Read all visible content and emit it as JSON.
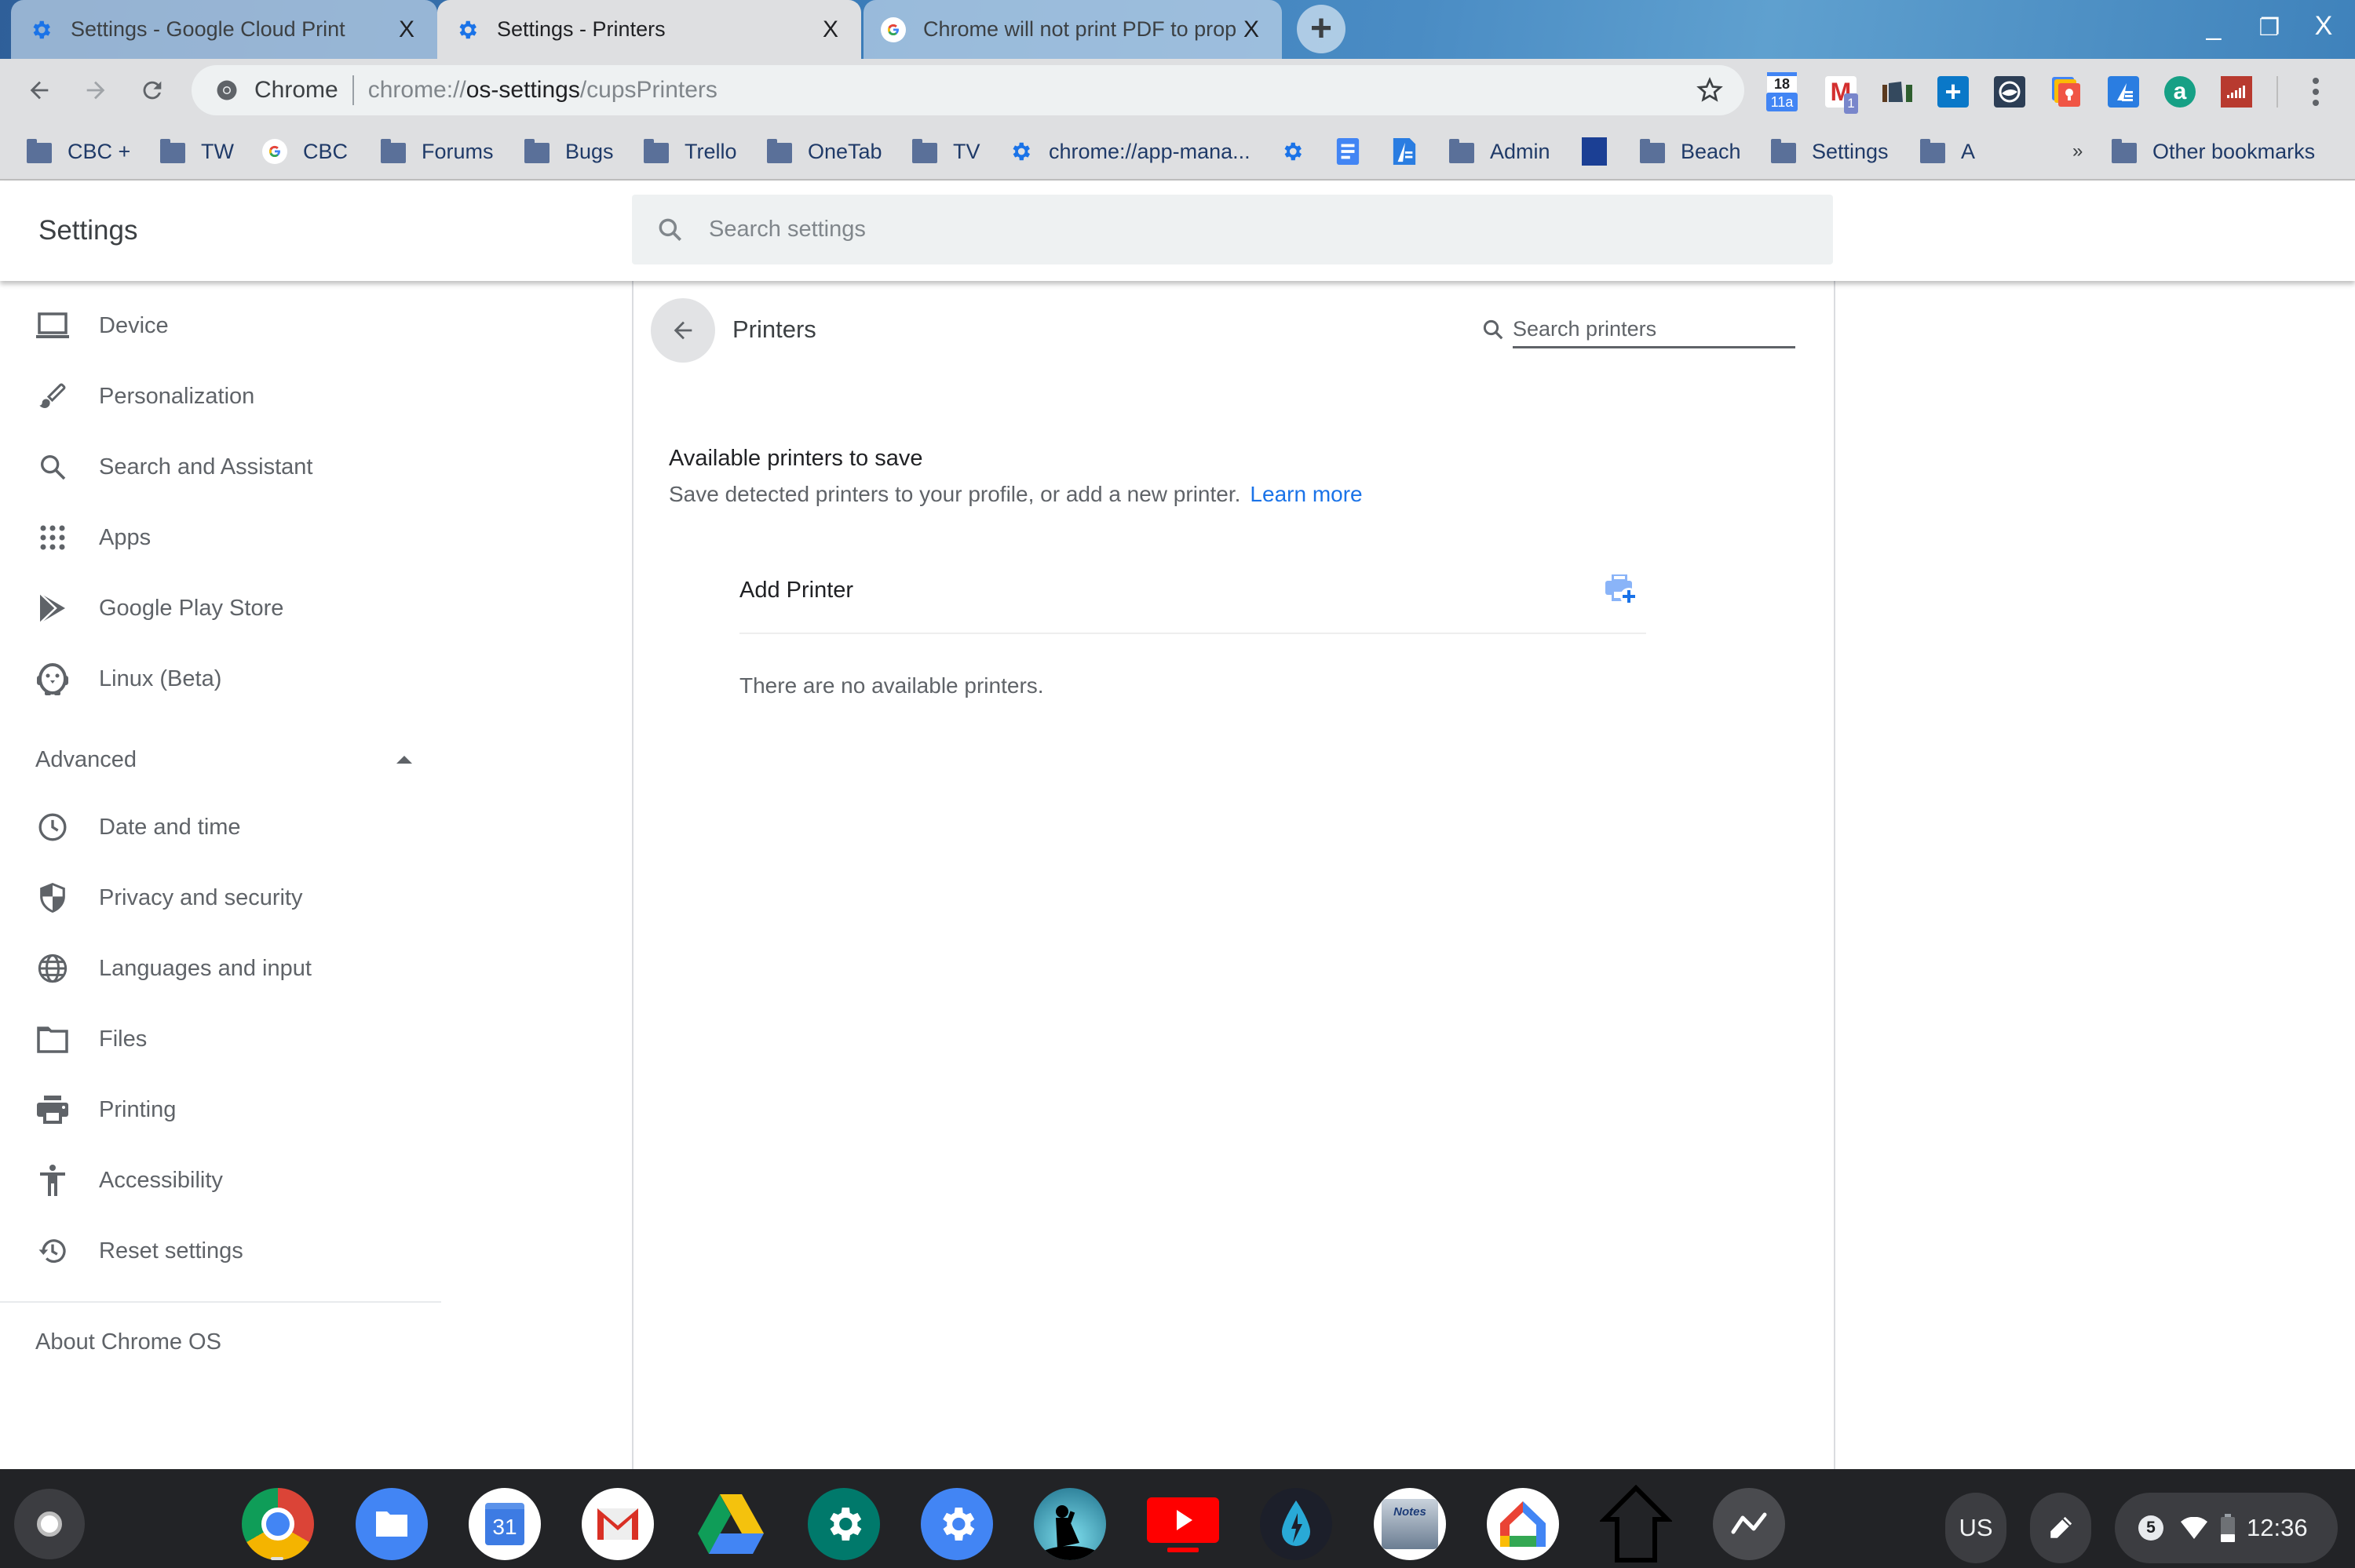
{
  "browser": {
    "tabs": [
      {
        "title": "Settings - Google Cloud Print",
        "favicon": "gear-icon",
        "active": false
      },
      {
        "title": "Settings - Printers",
        "favicon": "gear-icon",
        "active": true
      },
      {
        "title": "Chrome will not print PDF to prop",
        "favicon": "google-g-icon",
        "active": false
      }
    ],
    "tab_close_glyph": "X",
    "new_tab_glyph": "+",
    "window_controls": {
      "minimize": "_",
      "restore": "❐",
      "close": "X"
    },
    "omnibox": {
      "chip": "Chrome",
      "url_prefix": "chrome://",
      "url_host": "os-settings",
      "url_path": "/cupsPrinters"
    },
    "extensions": [
      {
        "name": "calendar-extension",
        "top": "18",
        "badge": "11a",
        "color": "#4285f4"
      },
      {
        "name": "gmail-checker-extension",
        "glyph": "M",
        "badge": "1",
        "color": "#d32f2f"
      },
      {
        "name": "bookshelf-extension",
        "color": "#34495e"
      },
      {
        "name": "plus-extension",
        "glyph": "+",
        "color": "#0a78c8"
      },
      {
        "name": "wave-extension",
        "color": "#2c3e55"
      },
      {
        "name": "keep-extension",
        "color": "#f05545"
      },
      {
        "name": "docs-quill-extension",
        "color": "#2a7de1"
      },
      {
        "name": "amazon-assistant-extension",
        "glyph": "a",
        "color": "#16a085"
      },
      {
        "name": "signal-stats-extension",
        "color": "#b83a2f"
      }
    ],
    "bookmarks": [
      {
        "label": "CBC +",
        "icon": "folder"
      },
      {
        "label": "TW",
        "icon": "folder"
      },
      {
        "label": "CBC",
        "icon": "google"
      },
      {
        "label": "Forums",
        "icon": "folder"
      },
      {
        "label": "Bugs",
        "icon": "folder"
      },
      {
        "label": "Trello",
        "icon": "folder"
      },
      {
        "label": "OneTab",
        "icon": "folder"
      },
      {
        "label": "TV",
        "icon": "folder"
      },
      {
        "label": "chrome://app-mana...",
        "icon": "gear"
      },
      {
        "label": "",
        "icon": "gear"
      },
      {
        "label": "",
        "icon": "docs"
      },
      {
        "label": "",
        "icon": "quill"
      },
      {
        "label": "Admin",
        "icon": "folder"
      },
      {
        "label": "",
        "icon": "weather"
      },
      {
        "label": "Beach",
        "icon": "folder"
      },
      {
        "label": "Settings",
        "icon": "folder"
      },
      {
        "label": "A",
        "icon": "folder"
      }
    ],
    "overflow_glyph": "»",
    "other_bookmarks": "Other bookmarks"
  },
  "settings": {
    "app_title": "Settings",
    "search_placeholder": "Search settings",
    "sidebar": {
      "items": [
        {
          "label": "Device",
          "icon": "laptop-icon"
        },
        {
          "label": "Personalization",
          "icon": "brush-icon"
        },
        {
          "label": "Search and Assistant",
          "icon": "search-icon"
        },
        {
          "label": "Apps",
          "icon": "apps-grid-icon"
        },
        {
          "label": "Google Play Store",
          "icon": "play-store-icon"
        },
        {
          "label": "Linux (Beta)",
          "icon": "penguin-icon"
        }
      ],
      "advanced_label": "Advanced",
      "advanced_items": [
        {
          "label": "Date and time",
          "icon": "clock-icon"
        },
        {
          "label": "Privacy and security",
          "icon": "shield-icon"
        },
        {
          "label": "Languages and input",
          "icon": "globe-icon"
        },
        {
          "label": "Files",
          "icon": "folder-icon"
        },
        {
          "label": "Printing",
          "icon": "printer-icon"
        },
        {
          "label": "Accessibility",
          "icon": "accessibility-icon"
        },
        {
          "label": "Reset settings",
          "icon": "history-icon"
        }
      ],
      "about_label": "About Chrome OS"
    },
    "page": {
      "title": "Printers",
      "search_placeholder": "Search printers",
      "section_title": "Available printers to save",
      "section_desc": "Save detected printers to your profile, or add a new printer.",
      "learn_more": "Learn more",
      "add_printer_label": "Add Printer",
      "empty_message": "There are no available printers."
    }
  },
  "shelf": {
    "apps": [
      {
        "name": "chrome-app",
        "running": true
      },
      {
        "name": "files-app"
      },
      {
        "name": "calendar-app",
        "text": "31"
      },
      {
        "name": "gmail-app"
      },
      {
        "name": "drive-app"
      },
      {
        "name": "android-settings-app"
      },
      {
        "name": "chrome-settings-app"
      },
      {
        "name": "kindle-app"
      },
      {
        "name": "youtube-tv-app"
      },
      {
        "name": "dolphin-app"
      },
      {
        "name": "notes-app",
        "text": "Notes"
      },
      {
        "name": "google-home-app"
      },
      {
        "name": "home-outline-app"
      },
      {
        "name": "analytics-app"
      }
    ],
    "ime": "US",
    "notification_count": "5",
    "time": "12:36"
  },
  "colors": {
    "accent": "#1a73e8",
    "text_primary": "#202124",
    "text_secondary": "#5f6368",
    "shelf_bg": "#222326"
  }
}
